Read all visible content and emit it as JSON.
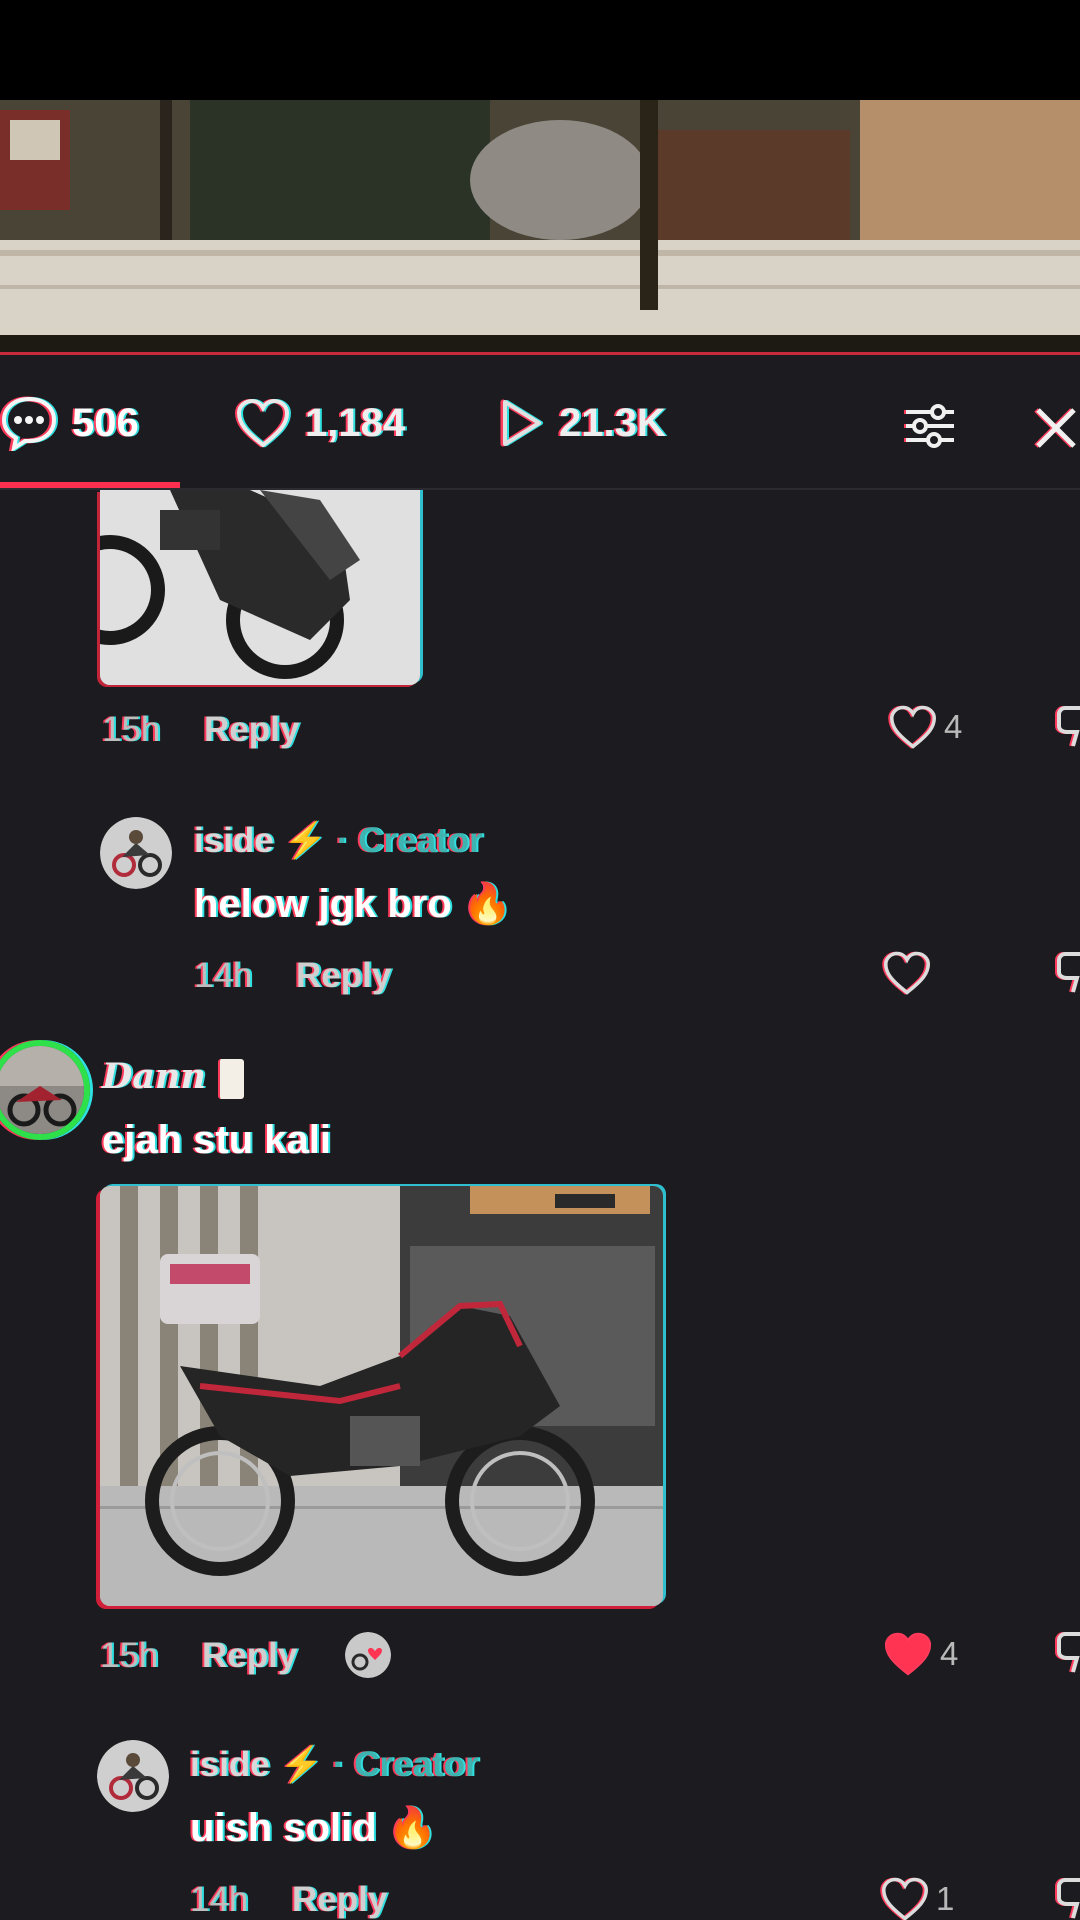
{
  "stats": {
    "comments": "506",
    "likes": "1,184",
    "plays": "21.3K",
    "comments_icon": "comment-bubble-icon",
    "likes_icon": "heart-outline-icon",
    "plays_icon": "play-icon",
    "filter_icon": "sliders-icon",
    "close_icon": "close-icon"
  },
  "comments": [
    {
      "time": "15h",
      "reply_label": "Reply",
      "like_count": "4"
    },
    {
      "username": "iside",
      "username_emoji": "⚡",
      "creator_label": "· Creator",
      "text": "helow jgk bro",
      "text_emoji": "🔥",
      "time": "14h",
      "reply_label": "Reply",
      "like_count": ""
    },
    {
      "username": "Dann",
      "text": "ejah stu kali",
      "time": "15h",
      "reply_label": "Reply",
      "like_count": "4",
      "liked": true
    },
    {
      "username": "iside",
      "username_emoji": "⚡",
      "creator_label": "· Creator",
      "text": "uish solid",
      "text_emoji": "🔥",
      "time": "14h",
      "reply_label": "Reply",
      "like_count": "1"
    }
  ],
  "colors": {
    "background": "#1c1b1f",
    "accent_red": "#ff2f4f",
    "creator_teal": "#3fb3b0",
    "liked_heart": "#ff3352"
  }
}
